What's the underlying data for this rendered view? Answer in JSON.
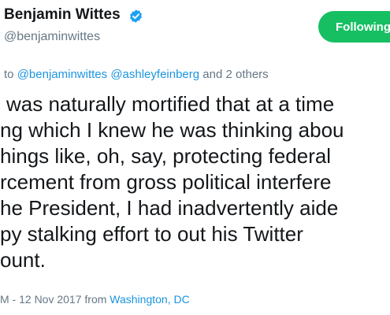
{
  "author": {
    "name": "Benjamin Wittes",
    "handle": "@benjaminwittes",
    "verified_icon": "verified-badge-icon"
  },
  "follow_button": {
    "label": "Following"
  },
  "reply": {
    "prefix": "to",
    "mention_1": "@benjaminwittes",
    "mention_2": "@ashleyfeinberg",
    "suffix": "and 2 others"
  },
  "tweet": {
    "lines": [
      "was naturally mortified that at a time",
      "ng which I knew he was thinking abou",
      "hings like, oh, say, protecting federal",
      "rcement from gross political interfere",
      "he President, I had inadvertently aide",
      "py stalking effort to out his Twitter",
      "ount."
    ]
  },
  "meta": {
    "timestamp": "M - 12 Nov 2017 from",
    "location": "Washington, DC"
  },
  "colors": {
    "follow_green": "#17bf63",
    "link_blue": "#1b95e0",
    "secondary_gray": "#657786"
  }
}
